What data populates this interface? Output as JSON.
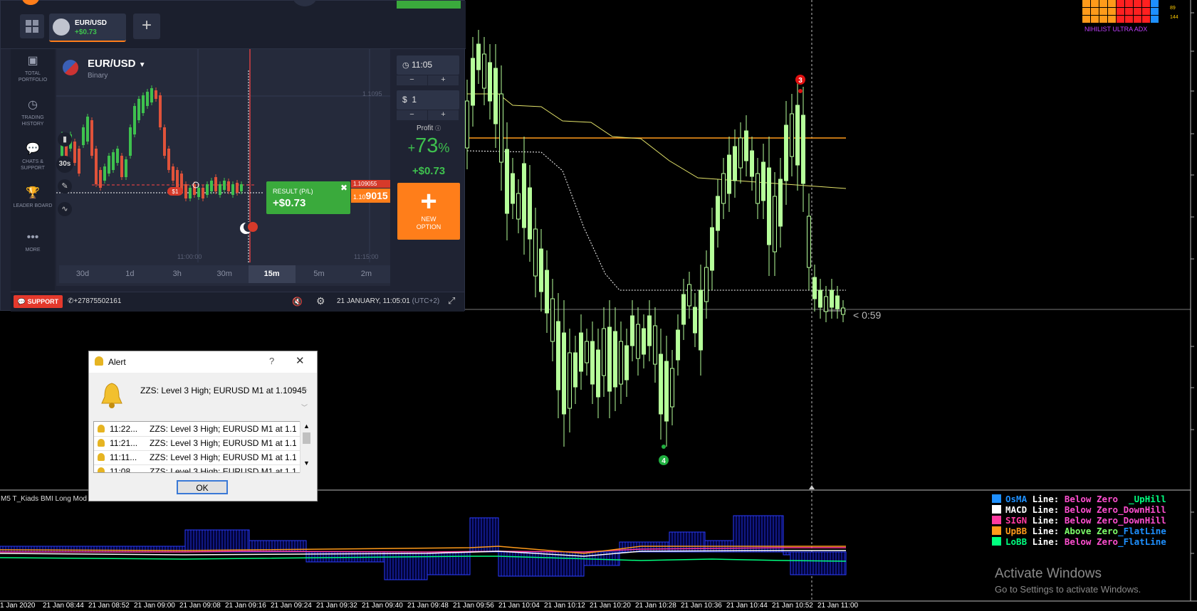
{
  "platform": {
    "tab": {
      "pair": "EUR/USD",
      "pnl": "+$0.73"
    },
    "nav": [
      {
        "icon": "briefcase-icon",
        "label": "TOTAL PORTFOLIO"
      },
      {
        "icon": "history-icon",
        "label": "TRADING HISTORY"
      },
      {
        "icon": "chat-icon",
        "label": "CHATS & SUPPORT"
      },
      {
        "icon": "trophy-icon",
        "label": "LEADER BOARD"
      },
      {
        "icon": "more-icon",
        "label": "MORE"
      }
    ],
    "asset": {
      "name": "EUR/USD",
      "type": "Binary"
    },
    "chart_tools": {
      "timeframe_label": "30s"
    },
    "price_labels": {
      "top": "1.1095",
      "current_small": "1.109055",
      "current_prefix": "1.10",
      "current_big": "9015"
    },
    "time_labels": [
      "11:00:00",
      "11:15:00"
    ],
    "result": {
      "title": "RESULT (P/L)",
      "value": "+$0.73"
    },
    "marker_label": "$1",
    "timeframes": [
      "30d",
      "1d",
      "3h",
      "30m",
      "15m",
      "5m",
      "2m"
    ],
    "active_timeframe": "15m",
    "expiry": {
      "time": "11:05",
      "minus": "−",
      "plus": "+"
    },
    "investment": {
      "currency": "$",
      "amount": "1",
      "minus": "−",
      "plus": "+"
    },
    "profit": {
      "label": "Profit",
      "plus": "+",
      "percent": "73",
      "percent_sign": "%",
      "value": "+$0.73"
    },
    "new_option": {
      "line1": "NEW",
      "line2": "OPTION"
    },
    "bottom": {
      "support": "SUPPORT",
      "phone": "+27875502161",
      "datetime": "21 JANUARY, 11:05:01",
      "tz": "(UTC+2)"
    }
  },
  "mt_chart": {
    "indicator_name": "NIHILIST ULTRA ADX",
    "indicator_values": [
      "89",
      "144"
    ],
    "countdown": "< 0:59",
    "marker_high": "3",
    "marker_low": "4",
    "sub_window_title": "M5 T_Kiads BMI Long Mod v",
    "legend": [
      {
        "color": "#1e90ff",
        "name": "OsMA",
        "text": "Line: Below Zero  _UpHill",
        "name_color": "#1e90ff",
        "label_color": "#ffffff",
        "state_color": "#ff4fd0",
        "trend_color": "#00ff7f",
        "label": "Line:",
        "state": "Below Zero",
        "trend": "  _UpHill"
      },
      {
        "color": "#ffffff",
        "name": "MACD",
        "label": "Line:",
        "state": "Below Zero",
        "trend": "_DownHill",
        "name_color": "#ffffff",
        "label_color": "#ffffff",
        "state_color": "#ff4fd0",
        "trend_color": "#ff4fd0"
      },
      {
        "color": "#ff3aa0",
        "name": "SIGN",
        "label": "Line:",
        "state": "Below Zero",
        "trend": "_DownHill",
        "name_color": "#ff3aa0",
        "label_color": "#ffffff",
        "state_color": "#ff4fd0",
        "trend_color": "#ff4fd0"
      },
      {
        "color": "#ff9a1a",
        "name": "UpBB",
        "label": "Line:",
        "state": "Above Zero",
        "trend": "_FlatLine",
        "name_color": "#ff9a1a",
        "label_color": "#ffffff",
        "state_color": "#7dff6a",
        "trend_color": "#1e90ff"
      },
      {
        "color": "#00ff7f",
        "name": "LoBB",
        "label": "Line:",
        "state": "Below Zero",
        "trend": "_FlatLine",
        "name_color": "#00ff7f",
        "label_color": "#ffffff",
        "state_color": "#ff4fd0",
        "trend_color": "#1e90ff"
      }
    ],
    "x_labels": [
      "1 Jan 2020",
      "21 Jan 08:44",
      "21 Jan 08:52",
      "21 Jan 09:00",
      "21 Jan 09:08",
      "21 Jan 09:16",
      "21 Jan 09:24",
      "21 Jan 09:32",
      "21 Jan 09:40",
      "21 Jan 09:48",
      "21 Jan 09:56",
      "21 Jan 10:04",
      "21 Jan 10:12",
      "21 Jan 10:20",
      "21 Jan 10:28",
      "21 Jan 10:36",
      "21 Jan 10:44",
      "21 Jan 10:52",
      "21 Jan 11:00"
    ],
    "activate": {
      "title": "Activate Windows",
      "subtitle": "Go to Settings to activate Windows."
    }
  },
  "alert": {
    "title": "Alert",
    "help": "?",
    "close": "✕",
    "message": "ZZS: Level 3 High; EURUSD  M1 at 1.10945",
    "rows": [
      {
        "time": "11:22...",
        "msg": "ZZS: Level 3 High; EURUSD  M1 at 1.10..."
      },
      {
        "time": "11:21...",
        "msg": "ZZS: Level 3 High; EURUSD  M1 at 1.10..."
      },
      {
        "time": "11:11...",
        "msg": "ZZS: Level 3 High; EURUSD  M1 at 1.10..."
      },
      {
        "time": "11:08...",
        "msg": "ZZS: Level 3 High; EURUSD  M1 at 1.10..."
      }
    ],
    "ok": "OK"
  }
}
